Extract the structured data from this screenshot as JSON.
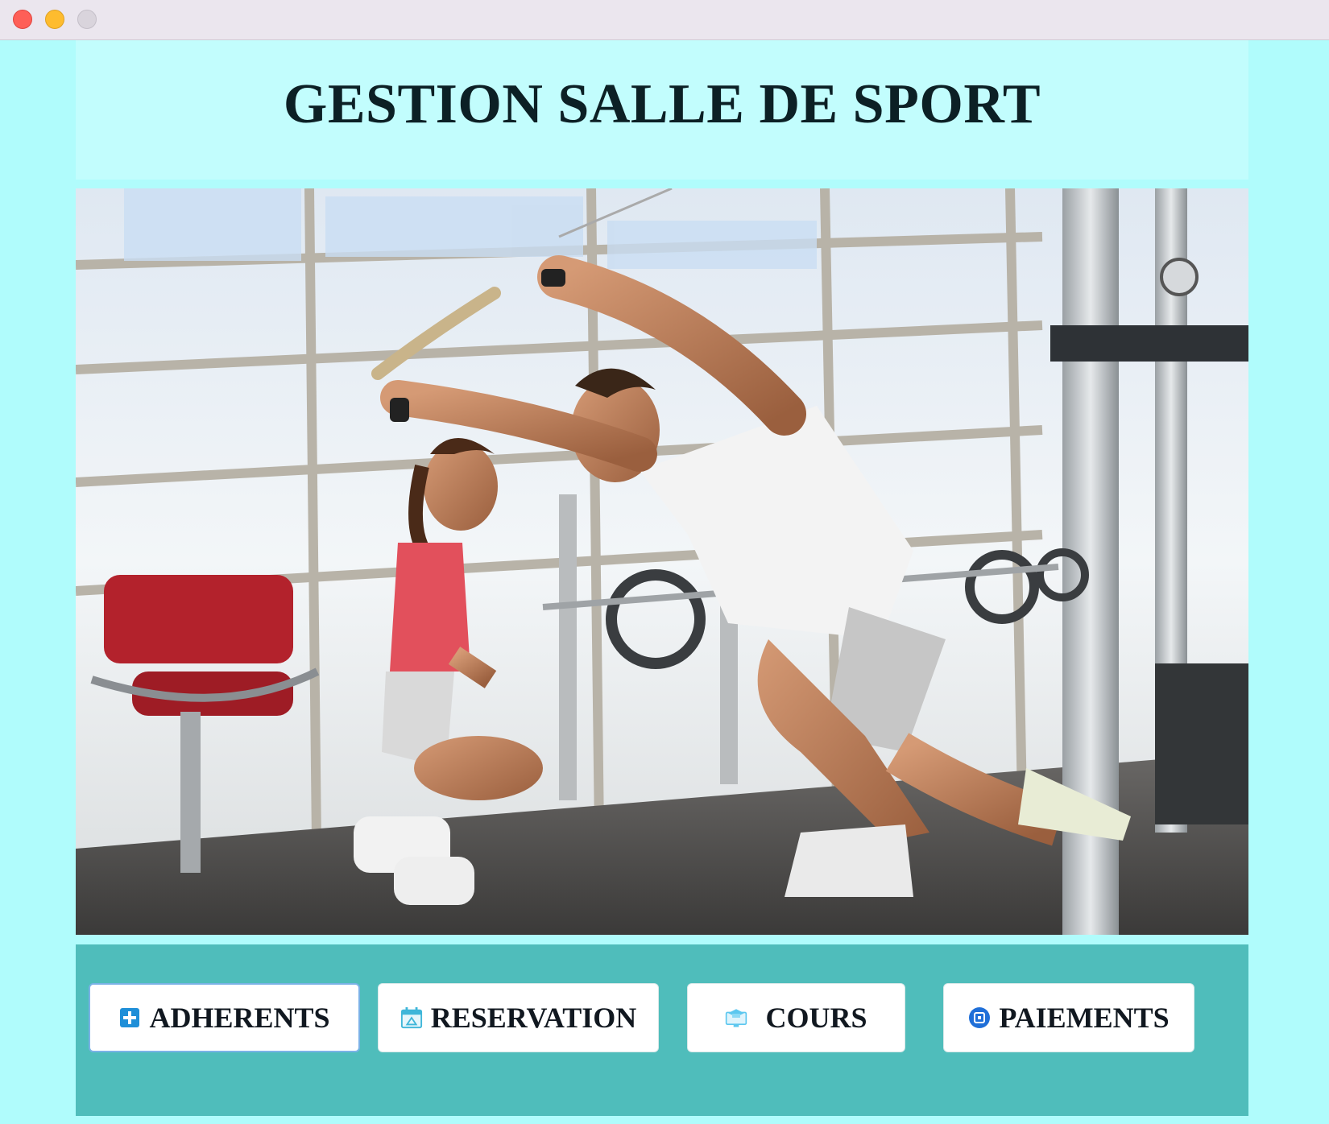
{
  "window": {
    "controls": [
      "close",
      "minimize",
      "maximize"
    ]
  },
  "header": {
    "title": "GESTION SALLE DE SPORT"
  },
  "hero": {
    "image_description_icon": "gym-photo"
  },
  "nav": {
    "buttons": [
      {
        "label": "ADHERENTS",
        "icon": "add-member-icon",
        "focused": true
      },
      {
        "label": "RESERVATION",
        "icon": "calendar-icon",
        "focused": false
      },
      {
        "label": "COURS",
        "icon": "graduation-monitor-icon",
        "focused": false
      },
      {
        "label": "PAIEMENTS",
        "icon": "payment-icon",
        "focused": false
      }
    ]
  },
  "colors": {
    "background": "#b0fcfc",
    "header_bg": "#c2fdfd",
    "button_panel_bg": "#4fbdbb",
    "title_text": "#0c2025",
    "focus_border": "#7ab2e6"
  }
}
